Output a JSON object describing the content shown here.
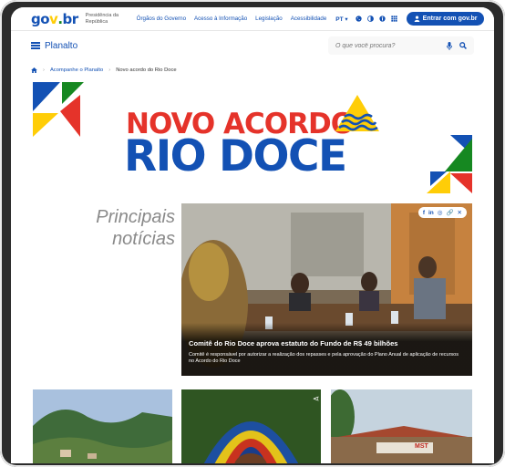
{
  "govbar": {
    "logo_parts": [
      "go",
      "v",
      ".",
      "br"
    ],
    "subtitle": "Presidência da República",
    "links": [
      "Órgãos do Governo",
      "Acesso à Informação",
      "Legislação",
      "Acessibilidade"
    ],
    "language": "PT ▾",
    "login_label": "Entrar com gov.br"
  },
  "header": {
    "menu_label": "Planalto",
    "search_placeholder": "O que você procura?"
  },
  "breadcrumb": {
    "items": [
      "Acompanhe o Planalto",
      "Novo acordo do Rio Doce"
    ]
  },
  "hero": {
    "line1": "NOVO ACORDO",
    "line2": "RIO DOCE"
  },
  "section": {
    "title_line1": "Principais",
    "title_line2": "notícias"
  },
  "news": {
    "title": "Comitê do Rio Doce aprova estatuto do Fundo de R$ 49 bilhões",
    "summary": "Comitê é responsável por autorizar a realização dos repasses e pela aprovação do Plano Anual de aplicação de recursos no Acordo do Rio Doce",
    "share_icons": [
      "facebook-icon",
      "linkedin-icon",
      "whatsapp-icon",
      "link-icon",
      "close-icon"
    ]
  },
  "cards": {
    "banner_text": "MST"
  },
  "colors": {
    "gov_blue": "#1351b4",
    "hero_red": "#e5332a",
    "gov_yellow": "#ffcd07",
    "gov_green": "#168821"
  }
}
